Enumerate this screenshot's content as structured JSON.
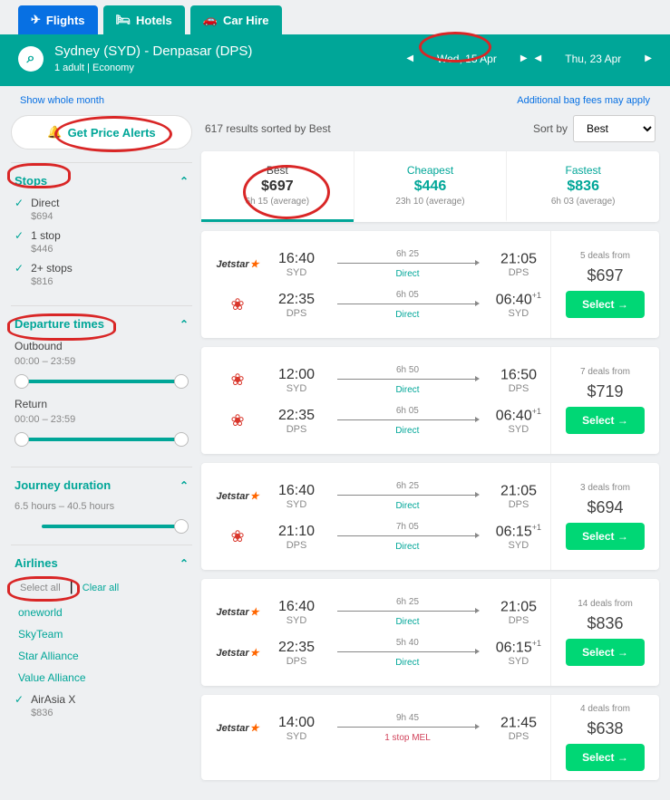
{
  "tabs": {
    "flights": "Flights",
    "hotels": "Hotels",
    "carhire": "Car Hire"
  },
  "search": {
    "route": "Sydney (SYD) - Denpasar (DPS)",
    "sub": "1 adult  |  Economy",
    "depart": "Wed, 15 Apr",
    "return": "Thu, 23 Apr"
  },
  "links": {
    "whole_month": "Show whole month",
    "bag_fees": "Additional bag fees may apply"
  },
  "alert": "Get Price Alerts",
  "results_count": "617 results sorted by Best",
  "sort_label": "Sort by",
  "sort_value": "Best",
  "summary": [
    {
      "title": "Best",
      "price": "$697",
      "sub": "6h 15 (average)"
    },
    {
      "title": "Cheapest",
      "price": "$446",
      "sub": "23h 10 (average)"
    },
    {
      "title": "Fastest",
      "price": "$836",
      "sub": "6h 03 (average)"
    }
  ],
  "filters": {
    "stops": {
      "title": "Stops",
      "items": [
        {
          "label": "Direct",
          "sub": "$694"
        },
        {
          "label": "1 stop",
          "sub": "$446"
        },
        {
          "label": "2+ stops",
          "sub": "$816"
        }
      ]
    },
    "times": {
      "title": "Departure times",
      "outbound": "Outbound",
      "outbound_range": "00:00 – 23:59",
      "return": "Return",
      "return_range": "00:00 – 23:59"
    },
    "duration": {
      "title": "Journey duration",
      "range": "6.5 hours – 40.5 hours"
    },
    "airlines": {
      "title": "Airlines",
      "select_all": "Select all",
      "clear_all": "Clear all",
      "alliances": [
        "oneworld",
        "SkyTeam",
        "Star Alliance",
        "Value Alliance"
      ],
      "carriers": [
        {
          "name": "AirAsia X",
          "price": "$836"
        }
      ]
    }
  },
  "select_label": "Select",
  "results": [
    {
      "deals": "5 deals from",
      "price": "$697",
      "legs": [
        {
          "logo": "jetstar",
          "dep_t": "16:40",
          "dep_c": "SYD",
          "dur": "6h 25",
          "stop": "Direct",
          "arr_t": "21:05",
          "arr_c": "DPS",
          "plus": ""
        },
        {
          "logo": "lion",
          "dep_t": "22:35",
          "dep_c": "DPS",
          "dur": "6h 05",
          "stop": "Direct",
          "arr_t": "06:40",
          "arr_c": "SYD",
          "plus": "+1"
        }
      ]
    },
    {
      "deals": "7 deals from",
      "price": "$719",
      "legs": [
        {
          "logo": "lion",
          "dep_t": "12:00",
          "dep_c": "SYD",
          "dur": "6h 50",
          "stop": "Direct",
          "arr_t": "16:50",
          "arr_c": "DPS",
          "plus": ""
        },
        {
          "logo": "lion",
          "dep_t": "22:35",
          "dep_c": "DPS",
          "dur": "6h 05",
          "stop": "Direct",
          "arr_t": "06:40",
          "arr_c": "SYD",
          "plus": "+1"
        }
      ]
    },
    {
      "deals": "3 deals from",
      "price": "$694",
      "legs": [
        {
          "logo": "jetstar",
          "dep_t": "16:40",
          "dep_c": "SYD",
          "dur": "6h 25",
          "stop": "Direct",
          "arr_t": "21:05",
          "arr_c": "DPS",
          "plus": ""
        },
        {
          "logo": "lion",
          "dep_t": "21:10",
          "dep_c": "DPS",
          "dur": "7h 05",
          "stop": "Direct",
          "arr_t": "06:15",
          "arr_c": "SYD",
          "plus": "+1"
        }
      ]
    },
    {
      "deals": "14 deals from",
      "price": "$836",
      "legs": [
        {
          "logo": "jetstar",
          "dep_t": "16:40",
          "dep_c": "SYD",
          "dur": "6h 25",
          "stop": "Direct",
          "arr_t": "21:05",
          "arr_c": "DPS",
          "plus": ""
        },
        {
          "logo": "jetstar",
          "dep_t": "22:35",
          "dep_c": "DPS",
          "dur": "5h 40",
          "stop": "Direct",
          "arr_t": "06:15",
          "arr_c": "SYD",
          "plus": "+1"
        }
      ]
    },
    {
      "deals": "4 deals from",
      "price": "$638",
      "legs": [
        {
          "logo": "jetstar",
          "dep_t": "14:00",
          "dep_c": "SYD",
          "dur": "9h 45",
          "stop": "1 stop MEL",
          "arr_t": "21:45",
          "arr_c": "DPS",
          "plus": ""
        }
      ]
    }
  ]
}
